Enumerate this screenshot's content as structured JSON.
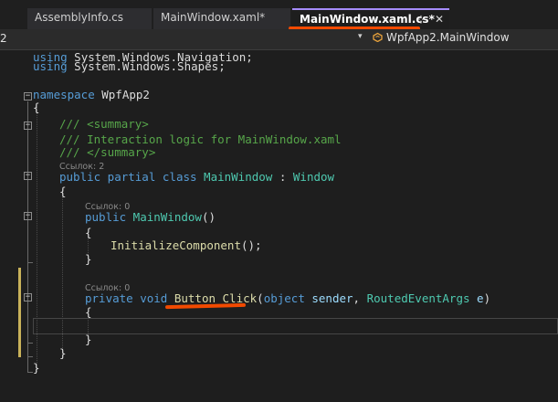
{
  "tabs": [
    {
      "label": "AssemblyInfo.cs",
      "active": false
    },
    {
      "label": "MainWindow.xaml*",
      "active": false
    },
    {
      "label": "MainWindow.xaml.cs*",
      "active": true
    }
  ],
  "tab_icons": {
    "pin": "⊹",
    "close": "✕"
  },
  "navbar": {
    "left_label": "2",
    "dropdown_icon": "▾",
    "right_label": "WpfApp2.MainWindow"
  },
  "code": {
    "l1": {
      "kw": "using",
      "rest": " System.Windows.Navigation;"
    },
    "l2": {
      "kw": "using",
      "rest": " System.Windows.Shapes;"
    },
    "l4": {
      "kw": "namespace",
      "rest": " WpfApp2"
    },
    "l5": "{",
    "l6": "/// <summary>",
    "l7": "/// Interaction logic for MainWindow.xaml",
    "l8": "/// </summary>",
    "ref_class": "Ссылок: 2",
    "l9": {
      "kw1": "public",
      "kw2": " partial",
      "kw3": " class",
      "name": " MainWindow",
      "sep": " : ",
      "base": "Window"
    },
    "l10": "{",
    "ref_ctor": "Ссылок: 0",
    "l12": {
      "kw": "public",
      "name": " MainWindow",
      "rest": "()"
    },
    "l13": "{",
    "l14": {
      "name": "InitializeComponent",
      "rest": "();"
    },
    "l15": "}",
    "ref_method": "Ссылок: 0",
    "l17": {
      "kw1": "private",
      "kw2": " void",
      "name": " Button_Click",
      "p1": "(",
      "ptype1": "object",
      "pname1": " sender",
      "comma": ", ",
      "ptype2": "RoutedEventArgs",
      "pname2": " e",
      "p2": ")"
    },
    "l18": "{",
    "l19": "",
    "l20": "}",
    "l21": "}",
    "l22": "}"
  },
  "colors": {
    "background": "#1e1e1e",
    "keyword": "#569cd6",
    "type": "#4ec9b0",
    "method": "#dcdcaa",
    "comment": "#57a64a",
    "active_tab_accent": "#a68cff",
    "annotation": "#f24a00"
  }
}
